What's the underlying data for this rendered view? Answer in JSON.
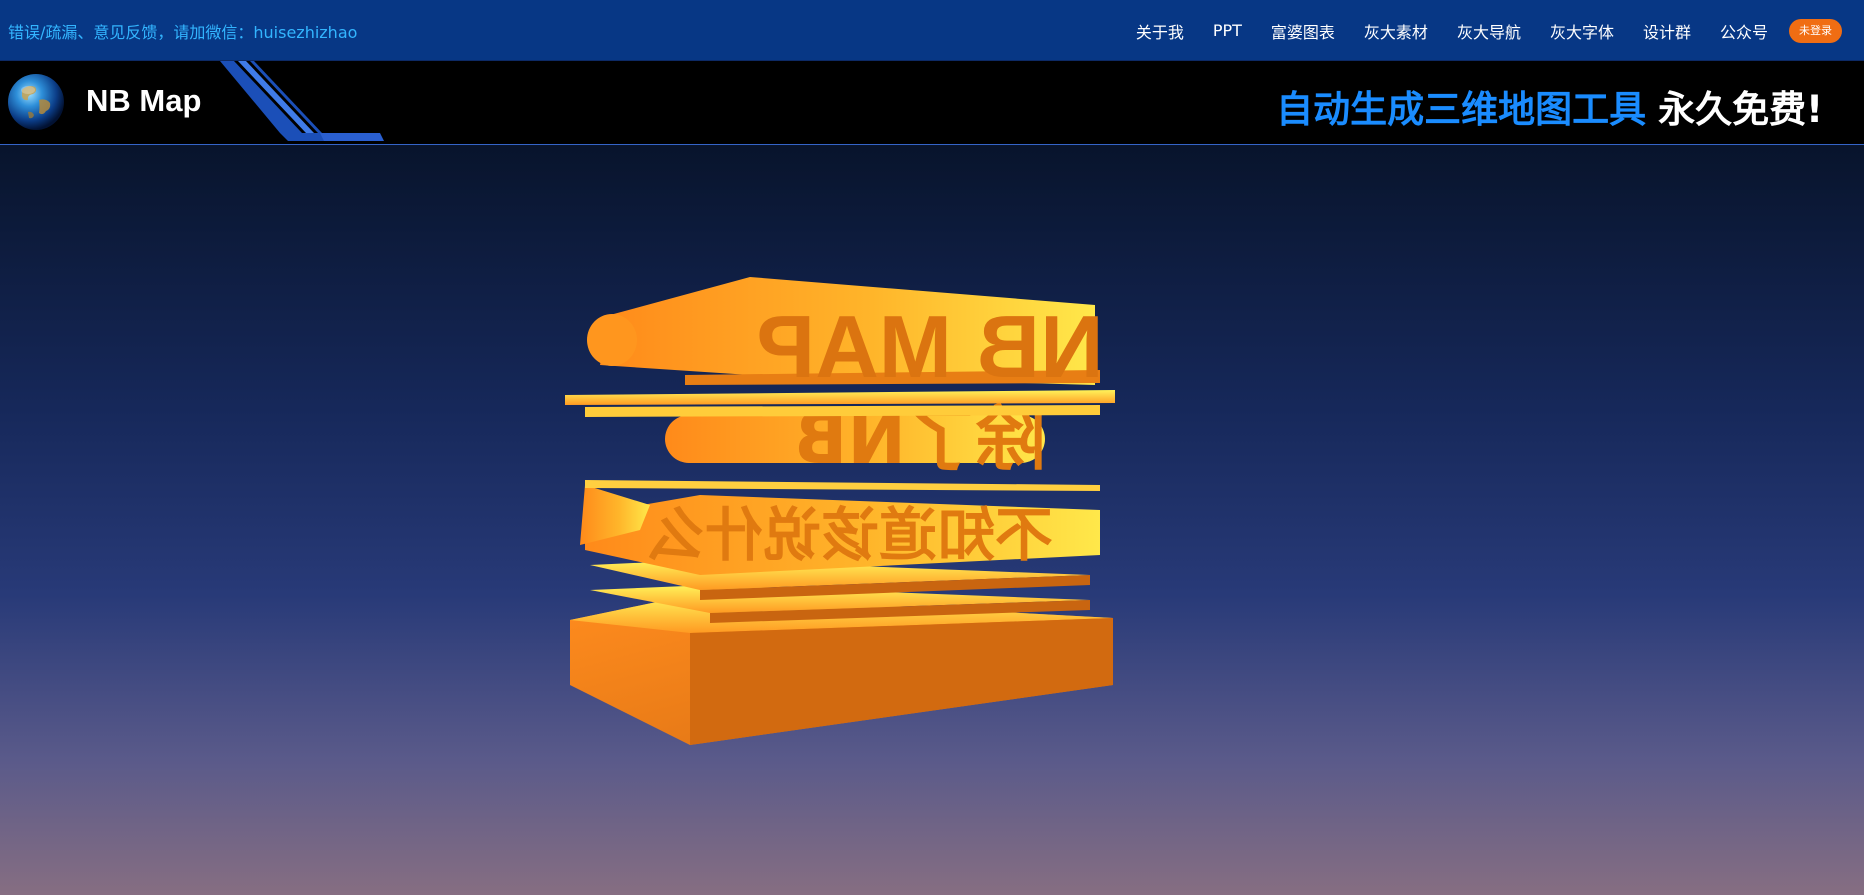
{
  "topbar": {
    "feedback": "错误/疏漏、意见反馈，请加微信：huisezhizhao",
    "nav": [
      "关于我",
      "PPT",
      "富婆图表",
      "灰大素材",
      "灰大导航",
      "灰大字体",
      "设计群",
      "公众号"
    ],
    "login": "未登录"
  },
  "header": {
    "brand": "NB Map",
    "slogan_blue": "自动生成三维地图工具",
    "slogan_white": "永久免费!"
  },
  "scene": {
    "line1": "NB MAP",
    "line2": "除了NB",
    "line3": "不知道该说什么"
  },
  "colors": {
    "topbar": "#073785",
    "accent": "#1a8cff",
    "login": "#f06d13",
    "extrusion": "#f08a1c",
    "highlight": "#fff15a"
  }
}
